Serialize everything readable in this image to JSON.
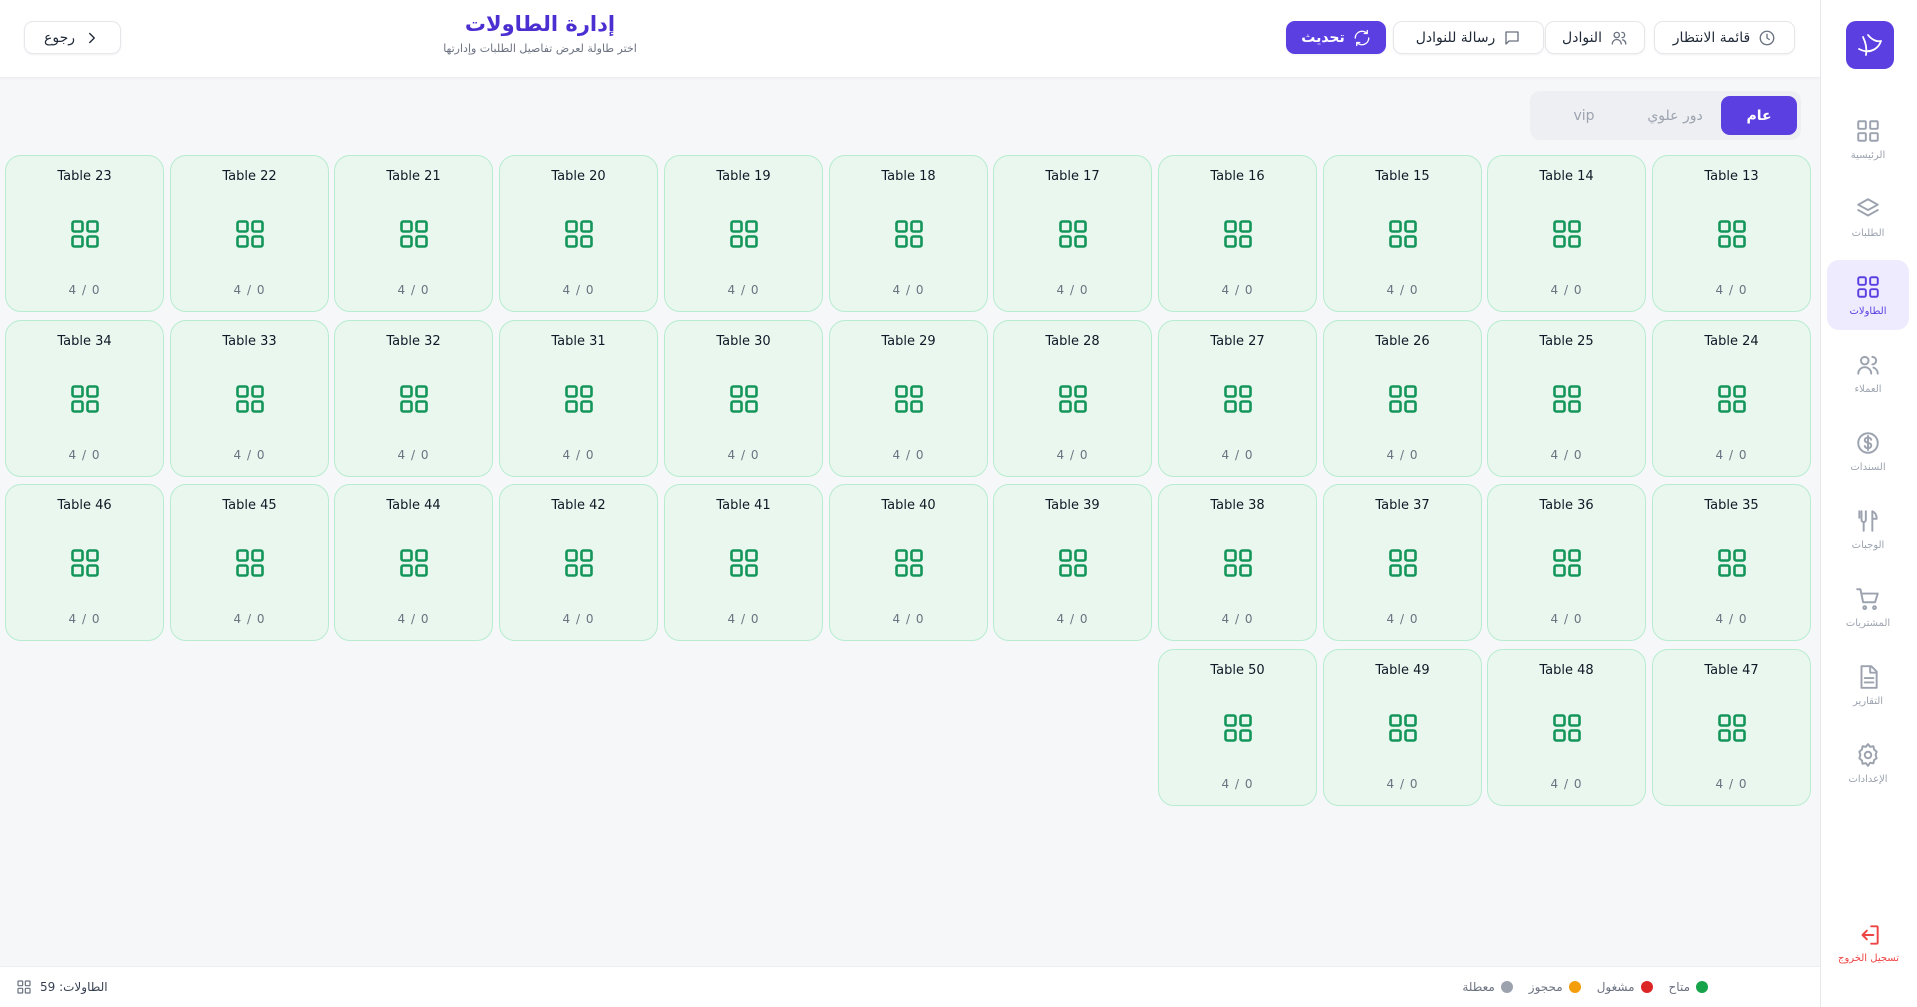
{
  "header": {
    "title": "إدارة الطاولات",
    "subtitle": "اختر طاولة لعرض تفاصيل الطلبات وإدارتها",
    "back_label": "رجوع",
    "refresh_label": "تحديث",
    "message_label": "رسالة للنوادل",
    "waiters_label": "النوادل",
    "waitlist_label": "قائمة الانتظار"
  },
  "floors": [
    "عام",
    "دور علوي",
    "vip"
  ],
  "active_floor": "عام",
  "sidebar": {
    "items": [
      {
        "label": "الرئيسية",
        "icon": "grid-icon"
      },
      {
        "label": "الطلبات",
        "icon": "layers-icon"
      },
      {
        "label": "الطاولات",
        "icon": "tables-icon"
      },
      {
        "label": "العملاء",
        "icon": "users-icon"
      },
      {
        "label": "السندات",
        "icon": "dollar-icon"
      },
      {
        "label": "الوجبات",
        "icon": "utensils-icon"
      },
      {
        "label": "المشتريات",
        "icon": "cart-icon"
      },
      {
        "label": "التقارير",
        "icon": "file-icon"
      },
      {
        "label": "الإعدادات",
        "icon": "gear-icon"
      }
    ],
    "active": "الطاولات",
    "logout_label": "تسجيل الخروج"
  },
  "tables": [
    {
      "name": "Table 13",
      "capacity": "4 / 0",
      "status": "available"
    },
    {
      "name": "Table 14",
      "capacity": "4 / 0",
      "status": "available"
    },
    {
      "name": "Table 15",
      "capacity": "4 / 0",
      "status": "available"
    },
    {
      "name": "Table 16",
      "capacity": "4 / 0",
      "status": "available"
    },
    {
      "name": "Table 17",
      "capacity": "4 / 0",
      "status": "available"
    },
    {
      "name": "Table 18",
      "capacity": "4 / 0",
      "status": "available"
    },
    {
      "name": "Table 19",
      "capacity": "4 / 0",
      "status": "available"
    },
    {
      "name": "Table 20",
      "capacity": "4 / 0",
      "status": "available"
    },
    {
      "name": "Table 21",
      "capacity": "4 / 0",
      "status": "available"
    },
    {
      "name": "Table 22",
      "capacity": "4 / 0",
      "status": "available"
    },
    {
      "name": "Table 23",
      "capacity": "4 / 0",
      "status": "available"
    },
    {
      "name": "Table 24",
      "capacity": "4 / 0",
      "status": "available"
    },
    {
      "name": "Table 25",
      "capacity": "4 / 0",
      "status": "available"
    },
    {
      "name": "Table 26",
      "capacity": "4 / 0",
      "status": "available"
    },
    {
      "name": "Table 27",
      "capacity": "4 / 0",
      "status": "available"
    },
    {
      "name": "Table 28",
      "capacity": "4 / 0",
      "status": "available"
    },
    {
      "name": "Table 29",
      "capacity": "4 / 0",
      "status": "available"
    },
    {
      "name": "Table 30",
      "capacity": "4 / 0",
      "status": "available"
    },
    {
      "name": "Table 31",
      "capacity": "4 / 0",
      "status": "available"
    },
    {
      "name": "Table 32",
      "capacity": "4 / 0",
      "status": "available"
    },
    {
      "name": "Table 33",
      "capacity": "4 / 0",
      "status": "available"
    },
    {
      "name": "Table 34",
      "capacity": "4 / 0",
      "status": "available"
    },
    {
      "name": "Table 35",
      "capacity": "4 / 0",
      "status": "available"
    },
    {
      "name": "Table 36",
      "capacity": "4 / 0",
      "status": "available"
    },
    {
      "name": "Table 37",
      "capacity": "4 / 0",
      "status": "available"
    },
    {
      "name": "Table 38",
      "capacity": "4 / 0",
      "status": "available"
    },
    {
      "name": "Table 39",
      "capacity": "4 / 0",
      "status": "available"
    },
    {
      "name": "Table 40",
      "capacity": "4 / 0",
      "status": "available"
    },
    {
      "name": "Table 41",
      "capacity": "4 / 0",
      "status": "available"
    },
    {
      "name": "Table 42",
      "capacity": "4 / 0",
      "status": "available"
    },
    {
      "name": "Table 44",
      "capacity": "4 / 0",
      "status": "available"
    },
    {
      "name": "Table 45",
      "capacity": "4 / 0",
      "status": "available"
    },
    {
      "name": "Table 46",
      "capacity": "4 / 0",
      "status": "available"
    },
    {
      "name": "Table 47",
      "capacity": "4 / 0",
      "status": "available"
    },
    {
      "name": "Table 48",
      "capacity": "4 / 0",
      "status": "available"
    },
    {
      "name": "Table 49",
      "capacity": "4 / 0",
      "status": "available"
    },
    {
      "name": "Table 50",
      "capacity": "4 / 0",
      "status": "available"
    }
  ],
  "legend": [
    {
      "label": "متاح",
      "color": "#16a34a"
    },
    {
      "label": "مشغول",
      "color": "#dc2626"
    },
    {
      "label": "محجوز",
      "color": "#f59e0b"
    },
    {
      "label": "معطلة",
      "color": "#9ca3af"
    }
  ],
  "footer": {
    "tables_count": "الطاولات: 59"
  },
  "colors": {
    "accent": "#5b3fe0",
    "table_bg": "#e9f7ee",
    "table_border": "#b8ecd0",
    "table_icon": "#14965a"
  }
}
